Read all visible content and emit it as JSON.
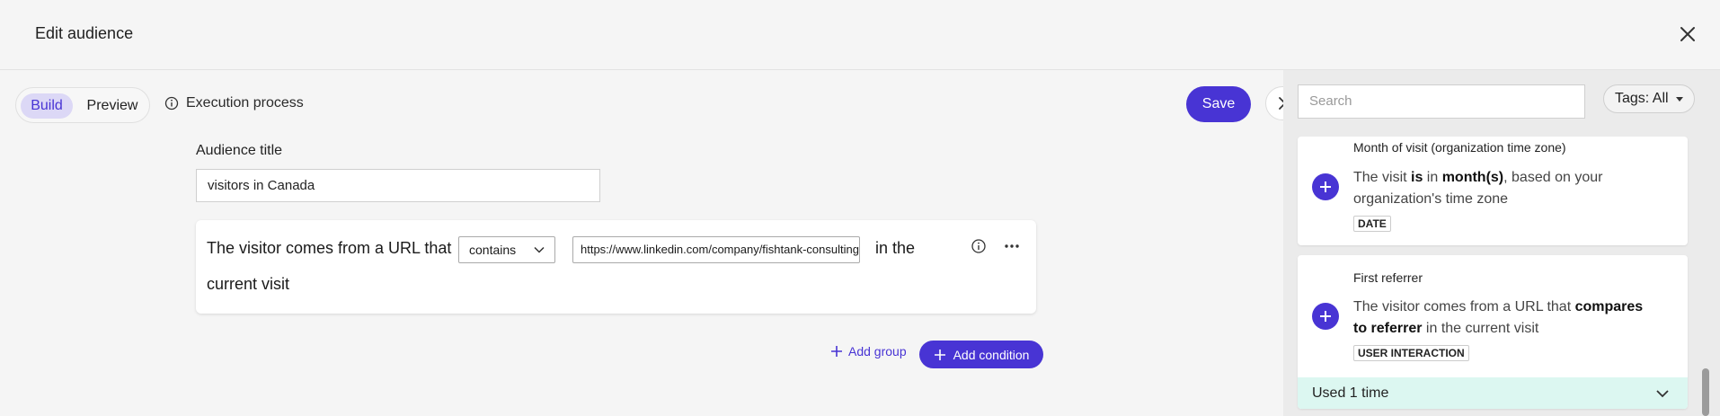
{
  "header": {
    "title": "Edit audience",
    "close_icon": "close-icon"
  },
  "toolbar": {
    "tabs": [
      {
        "label": "Build",
        "active": true
      },
      {
        "label": "Preview",
        "active": false
      }
    ],
    "execution_label": "Execution process",
    "save_label": "Save"
  },
  "audience": {
    "title_label": "Audience title",
    "title_value": "visitors in Canada"
  },
  "condition": {
    "prefix": "The visitor comes from a URL that",
    "operator": "contains",
    "url_value": "https://www.linkedin.com/company/fishtank-consulting",
    "suffix": "in the",
    "suffix2": "current visit"
  },
  "actions": {
    "add_group": "Add group",
    "add_condition": "Add condition"
  },
  "panel": {
    "search_placeholder": "Search",
    "tags_label": "Tags: All",
    "cards": [
      {
        "title": "Month of visit (organization time zone)",
        "desc_parts": [
          "The visit ",
          "is",
          " in ",
          "month(s)",
          ", based on your organization's time zone"
        ],
        "badge": "DATE"
      },
      {
        "title": "First referrer",
        "desc_parts": [
          "The visitor comes from a URL that ",
          "compares to referrer",
          "  in the current visit"
        ],
        "badge": "USER INTERACTION",
        "usage": "Used 1 time"
      }
    ]
  },
  "colors": {
    "accent": "#4834d4",
    "used_bg": "#dcf7f1",
    "build_tab_bg": "#dcd8f6"
  }
}
